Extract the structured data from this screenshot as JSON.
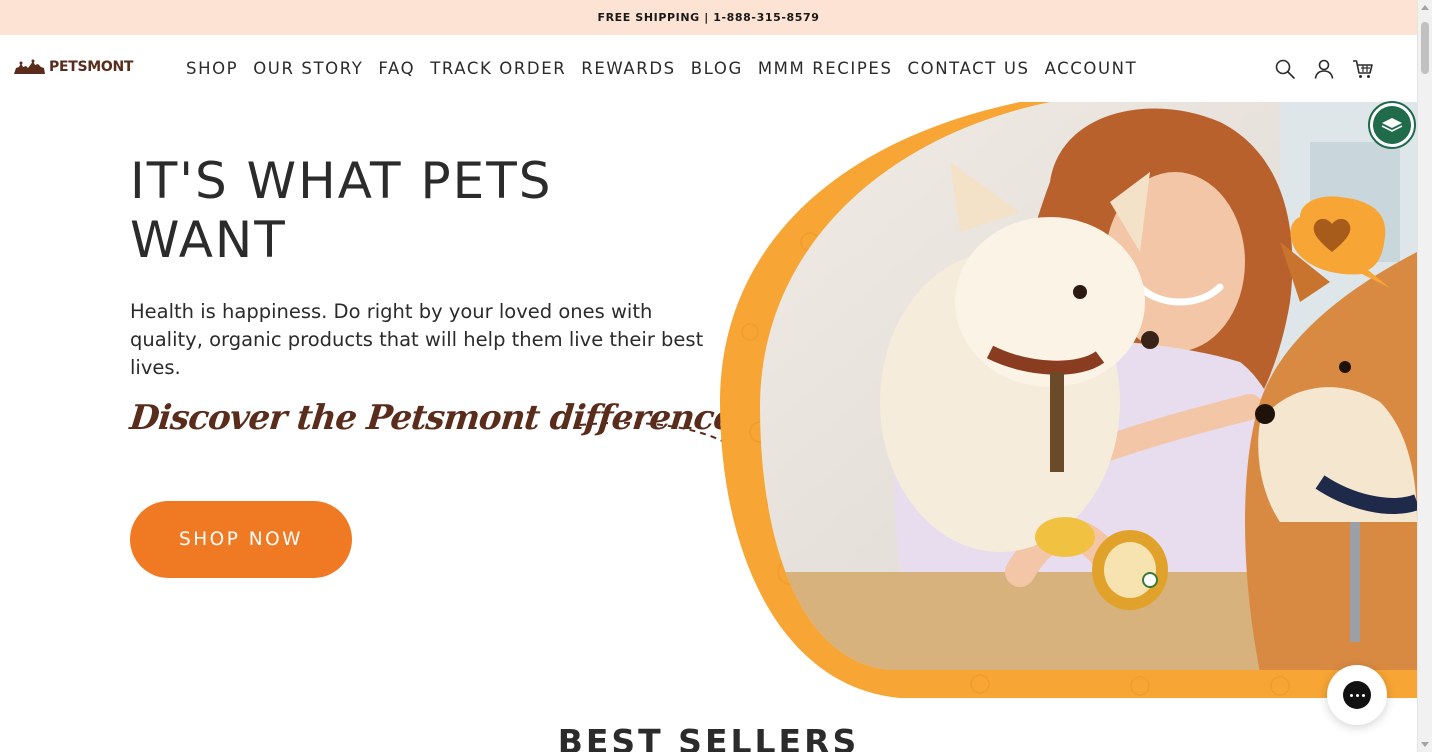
{
  "announcement": {
    "text": "FREE SHIPPING | 1-888-315-8579"
  },
  "brand": {
    "name": "PETSMONT",
    "color": "#5a2c1c"
  },
  "nav": {
    "items": [
      {
        "label": "SHOP"
      },
      {
        "label": "OUR STORY"
      },
      {
        "label": "FAQ"
      },
      {
        "label": "TRACK ORDER"
      },
      {
        "label": "REWARDS"
      },
      {
        "label": "BLOG"
      },
      {
        "label": "MMM RECIPES"
      },
      {
        "label": "CONTACT US"
      },
      {
        "label": "ACCOUNT"
      }
    ]
  },
  "header_icons": [
    "search-icon",
    "account-icon",
    "cart-icon"
  ],
  "hero": {
    "title": "IT'S WHAT PETS WANT",
    "subtitle": "Health is happiness. Do right by your loved ones with quality, organic products that will help them live their best lives.",
    "script": "Discover the Petsmont difference.",
    "cta_label": "SHOP NOW"
  },
  "colors": {
    "accent": "#f07a24",
    "announcement_bg": "#fde3d3",
    "hero_frame": "#f7a535",
    "brown": "#5a2c1c",
    "seal_green": "#1f6b4a"
  },
  "badges": {
    "seal_icon": "certification-seal-icon",
    "chat_icon": "chat-bubble-icon"
  },
  "section": {
    "title": "BEST SELLERS"
  }
}
